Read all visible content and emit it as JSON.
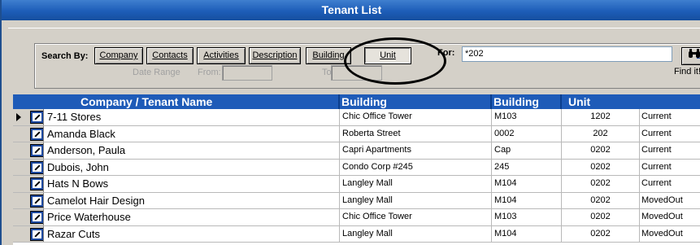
{
  "window": {
    "title": "Tenant List"
  },
  "search": {
    "label": "Search By:",
    "buttons": [
      {
        "label": "Company",
        "active": false
      },
      {
        "label": "Contacts",
        "active": false
      },
      {
        "label": "Activities",
        "active": false
      },
      {
        "label": "Description",
        "active": false
      },
      {
        "label": "Building",
        "active": false
      },
      {
        "label": "Unit",
        "active": true
      }
    ],
    "for_label": "For:",
    "for_value": "*202",
    "find_label": "Find it!",
    "find_icon": "binoculars-icon",
    "date_range_label": "Date Range",
    "from_label": "From:",
    "to_label": "To:"
  },
  "grid": {
    "columns": [
      "Company / Tenant Name",
      "Building",
      "Building",
      "Unit"
    ],
    "rows": [
      {
        "name": "7-11 Stores",
        "building": "Chic Office Tower",
        "code": "M103",
        "unit": "1202",
        "status": "Current",
        "current": true
      },
      {
        "name": "Amanda Black",
        "building": "Roberta Street",
        "code": "0002",
        "unit": "202",
        "status": "Current",
        "current": false
      },
      {
        "name": "Anderson, Paula",
        "building": "Capri Apartments",
        "code": "Cap",
        "unit": "0202",
        "status": "Current",
        "current": false
      },
      {
        "name": "Dubois, John",
        "building": "Condo Corp #245",
        "code": "245",
        "unit": "0202",
        "status": "Current",
        "current": false
      },
      {
        "name": "Hats N Bows",
        "building": "Langley Mall",
        "code": "M104",
        "unit": "0202",
        "status": "Current",
        "current": false
      },
      {
        "name": "Camelot Hair Design",
        "building": "Langley Mall",
        "code": "M104",
        "unit": "0202",
        "status": "MovedOut",
        "current": false
      },
      {
        "name": "Price Waterhouse",
        "building": "Chic Office Tower",
        "code": "M103",
        "unit": "0202",
        "status": "MovedOut",
        "current": false
      },
      {
        "name": "Razar Cuts",
        "building": "Langley Mall",
        "code": "M104",
        "unit": "0202",
        "status": "MovedOut",
        "current": false
      }
    ]
  },
  "colors": {
    "title_bar": "#1d5db8",
    "grid_header": "#1e5bb8",
    "face": "#d4d0c8"
  }
}
